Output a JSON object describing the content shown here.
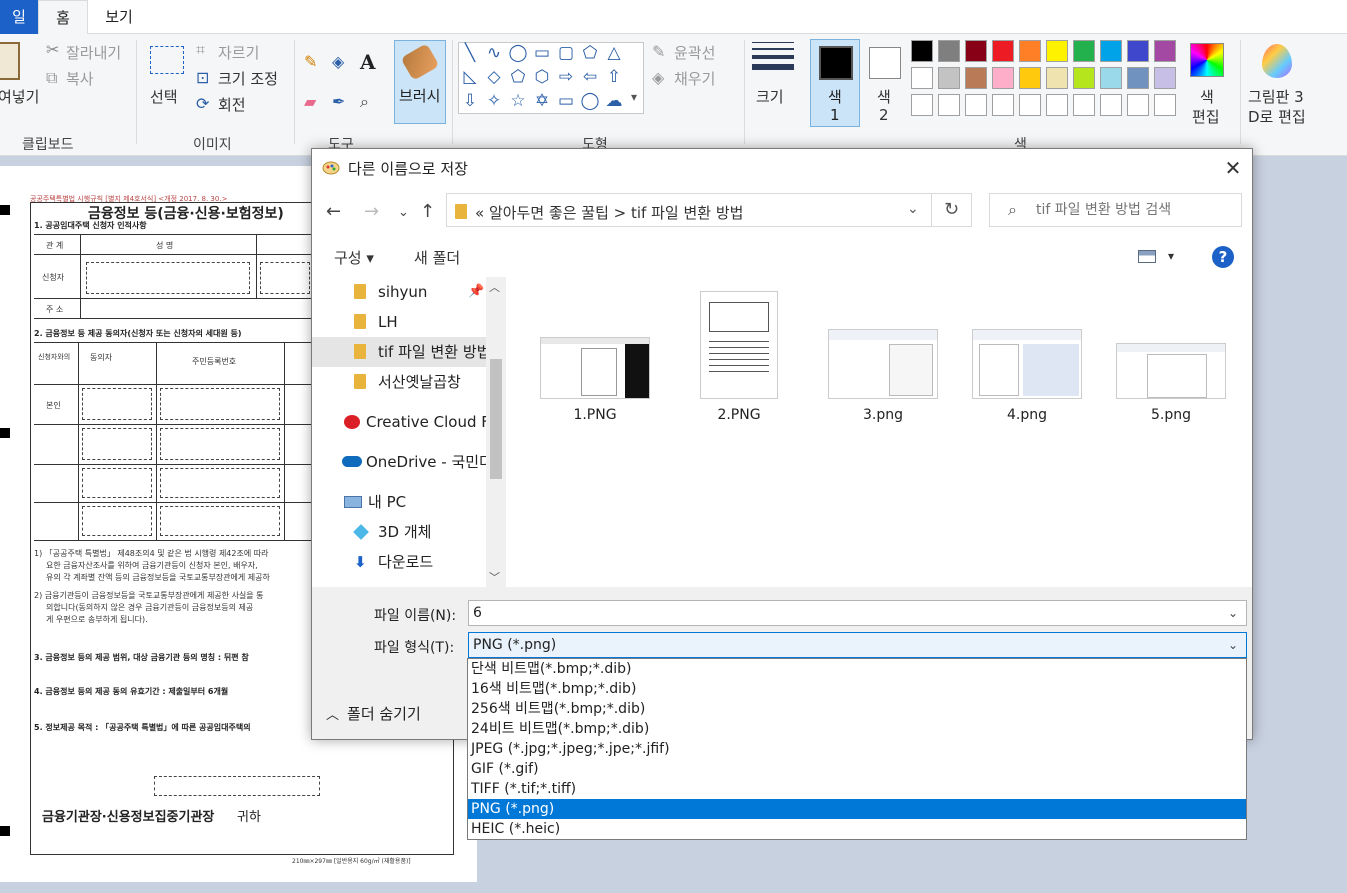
{
  "ribbon": {
    "tabs": [
      "파일",
      "홈",
      "보기"
    ],
    "tab_file_visible": "일",
    "clipboard": {
      "paste": "붙여넣기",
      "paste_visible": "여넣기",
      "cut": "잘라내기",
      "copy": "복사",
      "label": "클립보드"
    },
    "image": {
      "select": "선택",
      "crop": "자르기",
      "resize": "크기 조정",
      "rotate": "회전",
      "label": "이미지"
    },
    "tools": {
      "label": "도구"
    },
    "brushes": "브러시",
    "shapes": {
      "outline": "윤곽선",
      "fill": "채우기",
      "label": "도형"
    },
    "size": "크기",
    "color1": "색\n1",
    "color1_a": "색",
    "color1_b": "1",
    "color2_a": "색",
    "color2_b": "2",
    "edit_colors_a": "색",
    "edit_colors_b": "편집",
    "paint3d_a": "그림판 3",
    "paint3d_b": "D로 편집",
    "colors_label": "색",
    "palette": [
      "#000000",
      "#7f7f7f",
      "#880015",
      "#ed1c24",
      "#ff7f27",
      "#fff200",
      "#22b14c",
      "#00a2e8",
      "#3f48cc",
      "#a349a4",
      "#ffffff",
      "#c3c3c3",
      "#b97a57",
      "#ffaec9",
      "#ffc90e",
      "#efe4b0",
      "#b5e61d",
      "#99d9ea",
      "#7092be",
      "#c8bfe7"
    ]
  },
  "document": {
    "header": "공공주택특별법 시행규칙 [별지 제4호서식] <개정 2017. 8. 30.>",
    "title": "금융정보 등(금융·신용·보험정보)",
    "sec1": "1. 공공임대주택 신청자 인적사항",
    "col_kind": "관 계",
    "col_name": "성 명",
    "row_applicant": "신청자",
    "row_address": "주 소",
    "sec2": "2. 금융정보 등 제공 동의자(신청자 또는 신청자의 세대원 등)",
    "c2_a": "신청자와의\n관 계",
    "c2_b": "동의자\n성 명",
    "c2_c": "주민등록번호",
    "self": "본인",
    "note1a": "1) 「공공주택 특별법」 제48조의4 및 같은 법 시행령 제42조에 따라",
    "note1b": "요한 금융자산조사를 위하여 금융기관등이 신청자 본인, 배우자,",
    "note1c": "유의 각 계좌별 잔액 등의 금융정보등을 국토교통부장관에게 제공하",
    "note2a": "2) 금융기관등이 금융정보등을 국토교통부장관에게 제공한 사실을 통",
    "note2b": "의합니다(동의하지 않은 경우 금융기관등이 금융정보등의 제공",
    "note2c": "게 우편으로 송부하게 됩니다).",
    "sec3": "3. 금융정보 등의 제공 범위, 대상 금융기관 등의 명칭 : 뒤편 참",
    "sec4": "4. 금융정보 등의 제공 동의 유효기간 : 제출일부터 6개월",
    "sec5": "5. 정보제공 목적 : 「공공주택 특별법」에 따른 공공임대주택의",
    "recipient": "금융기관장·신용정보집중기관장",
    "recipient_suffix": "귀하",
    "footer": "210㎜×297㎜ [일반용지 60g/㎡ (재활용품)]"
  },
  "dialog": {
    "title": "다른 이름으로 저장",
    "breadcrumb": [
      "«",
      "알아두면 좋은 꿀팁",
      ">",
      "tif 파일 변환 방법"
    ],
    "breadcrumb_text": "«  알아두면 좋은 꿀팁  >  tif 파일 변환 방법",
    "search_placeholder": "tif 파일 변환 방법 검색",
    "organize": "구성 ▾",
    "new_folder": "새 폴더",
    "nav_items": [
      {
        "label": "sihyun",
        "type": "folder",
        "pinned": true
      },
      {
        "label": "LH",
        "type": "folder"
      },
      {
        "label": "tif 파일 변환 방법",
        "type": "folder",
        "selected": true
      },
      {
        "label": "서산옛날곱창",
        "type": "folder"
      },
      {
        "label": "Creative Cloud Fil",
        "type": "creative-cloud"
      },
      {
        "label": "OneDrive - 국민다",
        "type": "onedrive"
      },
      {
        "label": "내 PC",
        "type": "pc"
      },
      {
        "label": "3D 개체",
        "type": "3d"
      },
      {
        "label": "다운로드",
        "type": "download"
      }
    ],
    "files": [
      "1.PNG",
      "2.PNG",
      "3.png",
      "4.png",
      "5.png"
    ],
    "filename_label": "파일 이름(N):",
    "filename_value": "6",
    "filetype_label": "파일 형식(T):",
    "filetype_value": "PNG (*.png)",
    "hide_folders": "폴더 숨기기",
    "filetype_options": [
      "단색 비트맵(*.bmp;*.dib)",
      "16색 비트맵(*.bmp;*.dib)",
      "256색 비트맵(*.bmp;*.dib)",
      "24비트 비트맵(*.bmp;*.dib)",
      "JPEG (*.jpg;*.jpeg;*.jpe;*.jfif)",
      "GIF (*.gif)",
      "TIFF (*.tif;*.tiff)",
      "PNG (*.png)",
      "HEIC (*.heic)"
    ],
    "filetype_selected_index": 7
  }
}
